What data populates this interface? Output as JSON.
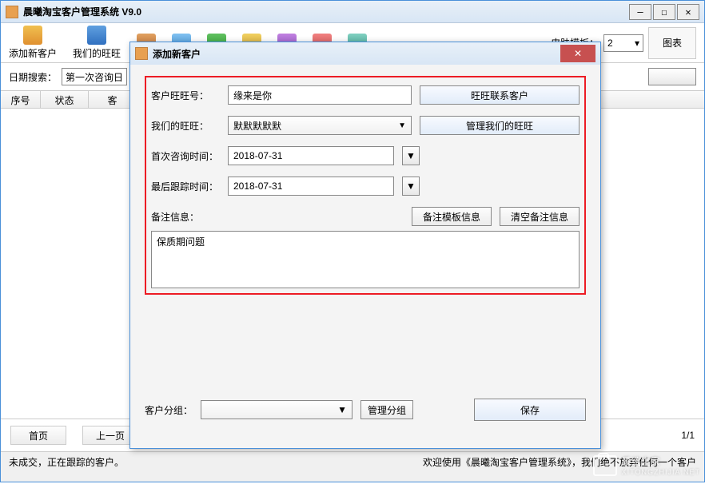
{
  "main": {
    "title": "晨曦淘宝客户管理系统  V9.0",
    "win_min": "—",
    "win_max": "☐",
    "win_close": "✕"
  },
  "toolbar": {
    "items": [
      "添加新客户",
      "我们的旺旺",
      "",
      "",
      "",
      "",
      "",
      "",
      ""
    ],
    "skin_label": "皮肤模板：",
    "skin_value": "2",
    "chart_btn": "图表"
  },
  "search": {
    "date_label": "日期搜索：",
    "date_type": "第一次咨询日"
  },
  "table": {
    "headers": [
      "序号",
      "状态",
      "客"
    ]
  },
  "pager": {
    "first": "首页",
    "prev": "上一页",
    "page": "1/1"
  },
  "status": {
    "left": "未成交，正在跟踪的客户。",
    "right": "欢迎使用《晨曦淘宝客户管理系统》，我们绝不放弃任何一个客户"
  },
  "dialog": {
    "title": "添加新客户",
    "close": "✕",
    "labels": {
      "wangwang": "客户旺旺号：",
      "our_wangwang": "我们的旺旺：",
      "first_time": "首次咨询时间：",
      "last_time": "最后跟踪时间：",
      "remark": "备注信息：",
      "group": "客户分组："
    },
    "values": {
      "wangwang": "缘来是你",
      "our_wangwang": "默默默默默",
      "first_time": "2018-07-31",
      "last_time": "2018-07-31",
      "remark": "保质期问题",
      "group": ""
    },
    "buttons": {
      "contact": "旺旺联系客户",
      "manage_our": "管理我们的旺旺",
      "remark_tpl": "备注模板信息",
      "remark_clear": "清空备注信息",
      "manage_group": "管理分组",
      "save": "保存"
    },
    "arrow": "▼"
  },
  "watermark": {
    "text": "系统之家",
    "sub": "XITONGZHIJIA.NET"
  }
}
